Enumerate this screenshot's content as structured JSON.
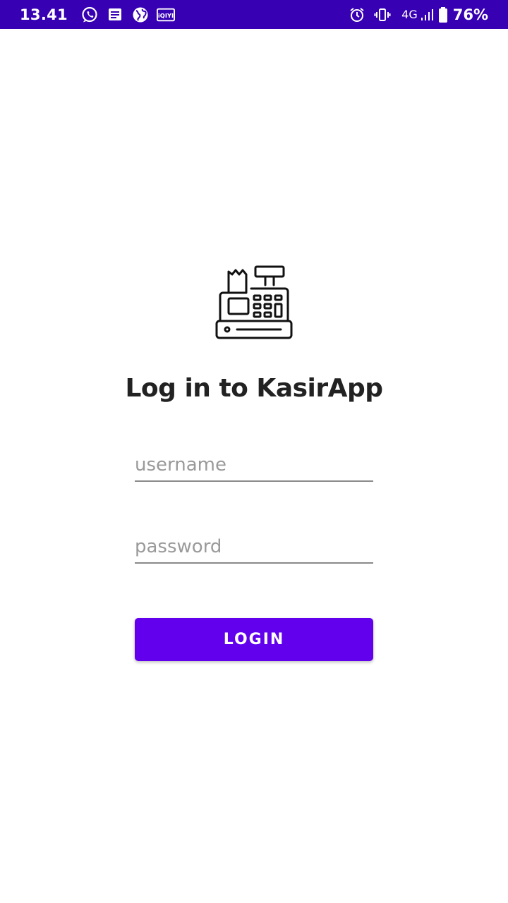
{
  "status_bar": {
    "time": "13.41",
    "network": "4G",
    "battery": "76%",
    "background_color": "#3700b3",
    "left_icons": [
      "whatsapp-icon",
      "message-icon",
      "globe-icon",
      "iqiyi-icon"
    ],
    "right_icons": [
      "alarm-icon",
      "vibrate-icon",
      "signal-icon",
      "battery-icon"
    ],
    "iqiyi_logo_text": "iQIYI"
  },
  "login": {
    "logo_icon": "cash-register-icon",
    "title": "Log in to KasirApp",
    "username_placeholder": "username",
    "password_placeholder": "password",
    "button_label": "LOGIN",
    "button_color": "#6200ee"
  }
}
